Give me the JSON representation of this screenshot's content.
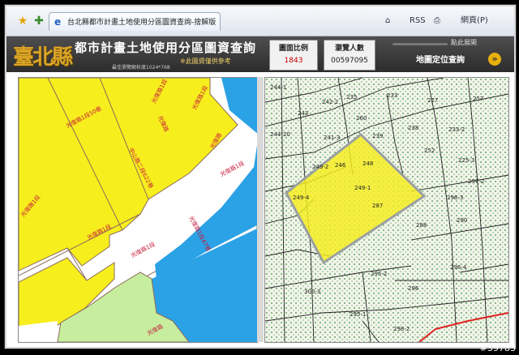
{
  "browser": {
    "tab_title": "台北縣都市計畫土地使用分區圖資查詢-捨解版",
    "home_label": "⌂",
    "rss_label": "RSS",
    "print_label": "⎙",
    "page_label": "網頁(P)"
  },
  "header": {
    "logo": "臺北縣",
    "title": "都市計畫土地使用分區圖資查詢",
    "resolution": "最佳瀏覽解析度1024*768",
    "notice": "※此圖資僅供參考",
    "scale_label": "圖面比例",
    "scale_value": "1843",
    "visits_label": "瀏覽人數",
    "visits_value": "00597095",
    "expand_label": "點此展開",
    "locate_label": "地圖定位查詢"
  },
  "left_map": {
    "colors": {
      "residential": "#f7ee1d",
      "water": "#2ca2e6",
      "park": "#c6ee9e",
      "road_text": "#c6183a"
    },
    "road_labels": [
      "光復路1段50巷",
      "光復路1段",
      "光復路1段",
      "中山路二段622巷",
      "光復路",
      "光復路",
      "光復路1段",
      "光復路1段47巷",
      "光復路1段",
      "光復路1段",
      "光復路1段",
      "光復路"
    ]
  },
  "right_map": {
    "parcel_labels": [
      "244-1",
      "242-2",
      "243",
      "235",
      "233",
      "227",
      "244-10",
      "260",
      "241-3",
      "239",
      "238",
      "233-2",
      "252",
      "249-2",
      "225-3",
      "246",
      "248",
      "249-4",
      "249-1",
      "287",
      "296-3",
      "288",
      "290",
      "297-2",
      "296-4",
      "295-2",
      "300-3",
      "296",
      "295-1",
      "298-2",
      "257"
    ]
  },
  "watermark": "#39783"
}
